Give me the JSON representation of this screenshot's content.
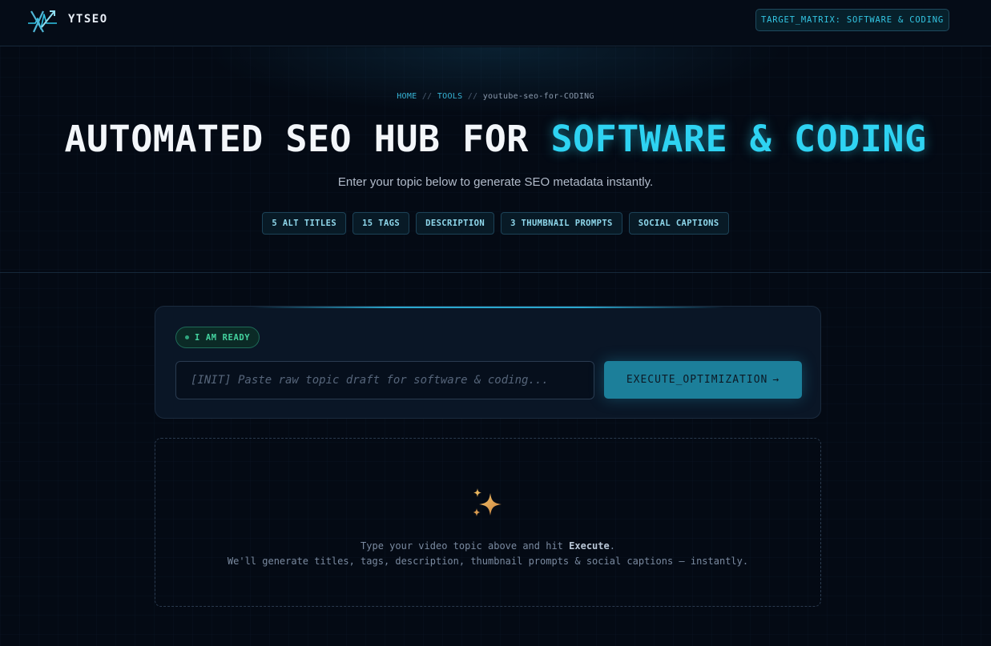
{
  "header": {
    "brand": "YTSEO",
    "target_matrix": "TARGET_MATRIX: SOFTWARE & CODING"
  },
  "hero": {
    "breadcrumb": {
      "home": "HOME",
      "separator": "//",
      "tools": "TOOLS",
      "current": "youtube-seo-for-CODING"
    },
    "headline_prefix": "AUTOMATED SEO HUB FOR ",
    "headline_accent": "SOFTWARE & CODING",
    "subtitle": "Enter your topic below to generate SEO metadata instantly.",
    "chips": [
      "5 ALT TITLES",
      "15 TAGS",
      "DESCRIPTION",
      "3 THUMBNAIL PROMPTS",
      "SOCIAL CAPTIONS"
    ]
  },
  "generator": {
    "status": "I AM READY",
    "input_placeholder": "[INIT] Paste raw topic draft for software & coding...",
    "input_value": "",
    "execute_label": "EXECUTE_OPTIMIZATION",
    "execute_arrow": "→"
  },
  "output": {
    "icon": "sparkles-icon",
    "hint_line1_prefix": "Type your video topic above and hit ",
    "hint_line1_bold": "Execute",
    "hint_line1_suffix": ".",
    "hint_line2": "We'll generate titles, tags, description, thumbnail prompts & social captions — instantly."
  },
  "colors": {
    "background": "#040a14",
    "accent": "#2ed3f2",
    "ready_green": "#44d39f",
    "button": "#1c7f9a"
  }
}
